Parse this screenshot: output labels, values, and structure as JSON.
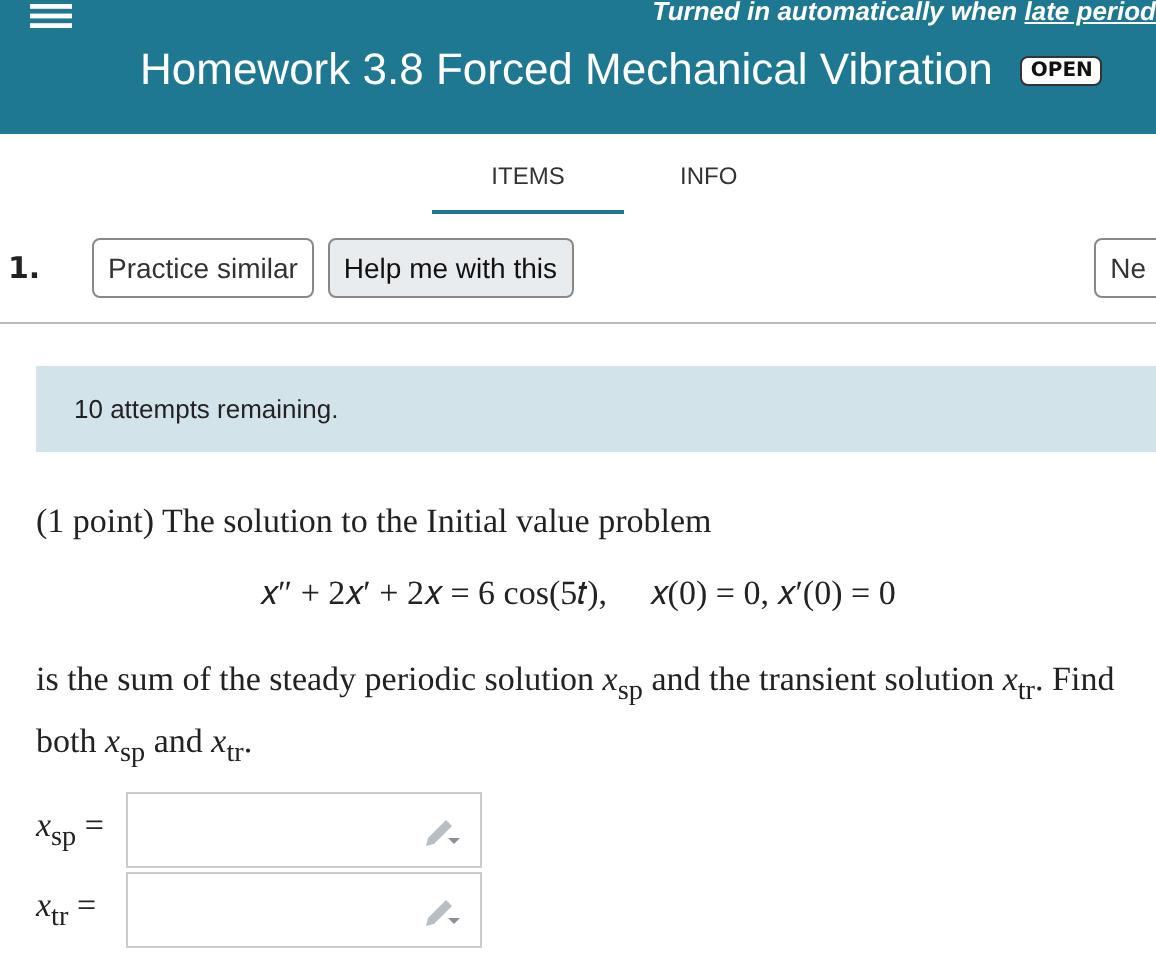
{
  "header": {
    "notice": "Turned in automatically when ",
    "notice_link": "late period",
    "title": "Homework 3.8 Forced Mechanical Vibration",
    "badge": "OPEN"
  },
  "tabs": [
    {
      "label": "ITEMS",
      "selected": true
    },
    {
      "label": "INFO",
      "selected": false
    }
  ],
  "item": {
    "number": "1.",
    "buttons": [
      {
        "label": "Practice similar",
        "kind": "outline"
      },
      {
        "label": "Help me with this",
        "kind": "filled"
      }
    ],
    "next_button": "Ne"
  },
  "alert": "10 attempts remaining.",
  "question": {
    "intro": "(1 point) The solution to the Initial value problem",
    "equation": "𝑥″ + 2𝑥′ + 2𝑥 = 6 cos(5𝑡),     𝑥(0) = 0, 𝑥′(0) = 0",
    "body": "is the sum of the steady periodic solution *x*$_{sp}$ and the transient solution *x*$_{tr}$. Find both *x*$_{sp}$ and *x*$_{tr}$.",
    "answers": [
      {
        "label": "*x*$_{sp}$ ="
      },
      {
        "label": "*x*$_{tr}$ ="
      }
    ]
  }
}
